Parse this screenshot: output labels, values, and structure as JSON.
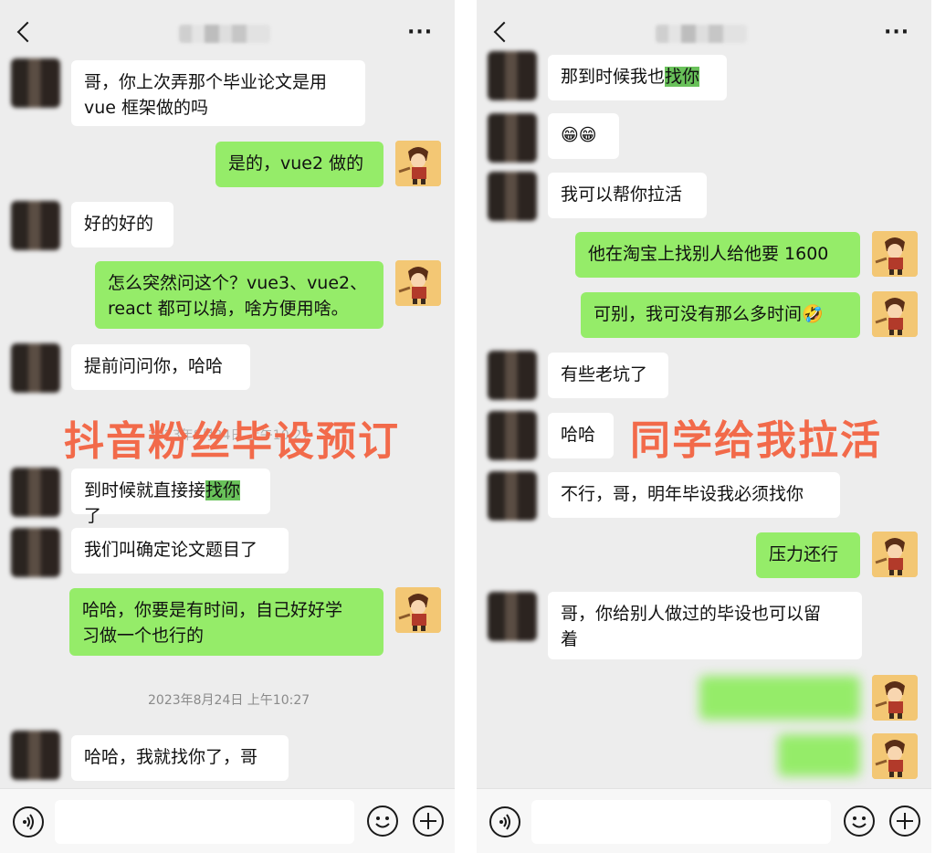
{
  "left": {
    "messages": [
      {
        "side": "in",
        "text": "哥，你上次弄那个毕业论文是用\nvue 框架做的吗"
      },
      {
        "side": "out",
        "text": "是的，vue2 做的"
      },
      {
        "side": "in",
        "text": "好的好的"
      },
      {
        "side": "out",
        "text": "怎么突然问这个？vue3、vue2、\nreact 都可以搞，啥方便用啥。"
      },
      {
        "side": "in",
        "text": "提前问问你，哈哈"
      },
      {
        "side": "in",
        "pre": "到时候就直接接",
        "hl": "找你",
        "post": "了"
      },
      {
        "side": "in",
        "text": "我们叫确定论文题目了"
      },
      {
        "side": "out",
        "text": "哈哈，你要是有时间，自己好好学\n习做一个也行的"
      },
      {
        "side": "in",
        "text": "哈哈，我就找你了，哥"
      }
    ],
    "timestamp_faded": "2023年8月24日 上午10:27",
    "timestamp": "2023年8月24日 上午10:27",
    "overlay": "抖音粉丝毕设预订"
  },
  "right": {
    "messages": [
      {
        "side": "in",
        "pre": "那到时候我也",
        "hl": "找你",
        "post": ""
      },
      {
        "side": "in",
        "text": "😁😁"
      },
      {
        "side": "in",
        "text": "我可以帮你拉活"
      },
      {
        "side": "out",
        "text": "他在淘宝上找别人给他要 1600"
      },
      {
        "side": "out",
        "text": "可别，我可没有那么多时间🤣"
      },
      {
        "side": "in",
        "text": "有些老坑了"
      },
      {
        "side": "in",
        "text": "哈哈"
      },
      {
        "side": "in",
        "text": "不行，哥，明年毕设我必须找你"
      },
      {
        "side": "out",
        "text": "压力还行"
      },
      {
        "side": "in",
        "text": "哥，你给别人做过的毕设也可以留\n着"
      }
    ],
    "overlay": "同学给我拉活"
  },
  "icons": {
    "back": "back-chevron-icon",
    "more": "more-dots-icon",
    "voice": "voice-icon",
    "emoji": "emoji-icon",
    "plus": "plus-icon"
  },
  "colors": {
    "background": "#ededed",
    "bubble_out": "#95ec69",
    "bubble_in": "#ffffff",
    "highlight": "#69c15a",
    "overlay_text": "#f26a4a"
  }
}
